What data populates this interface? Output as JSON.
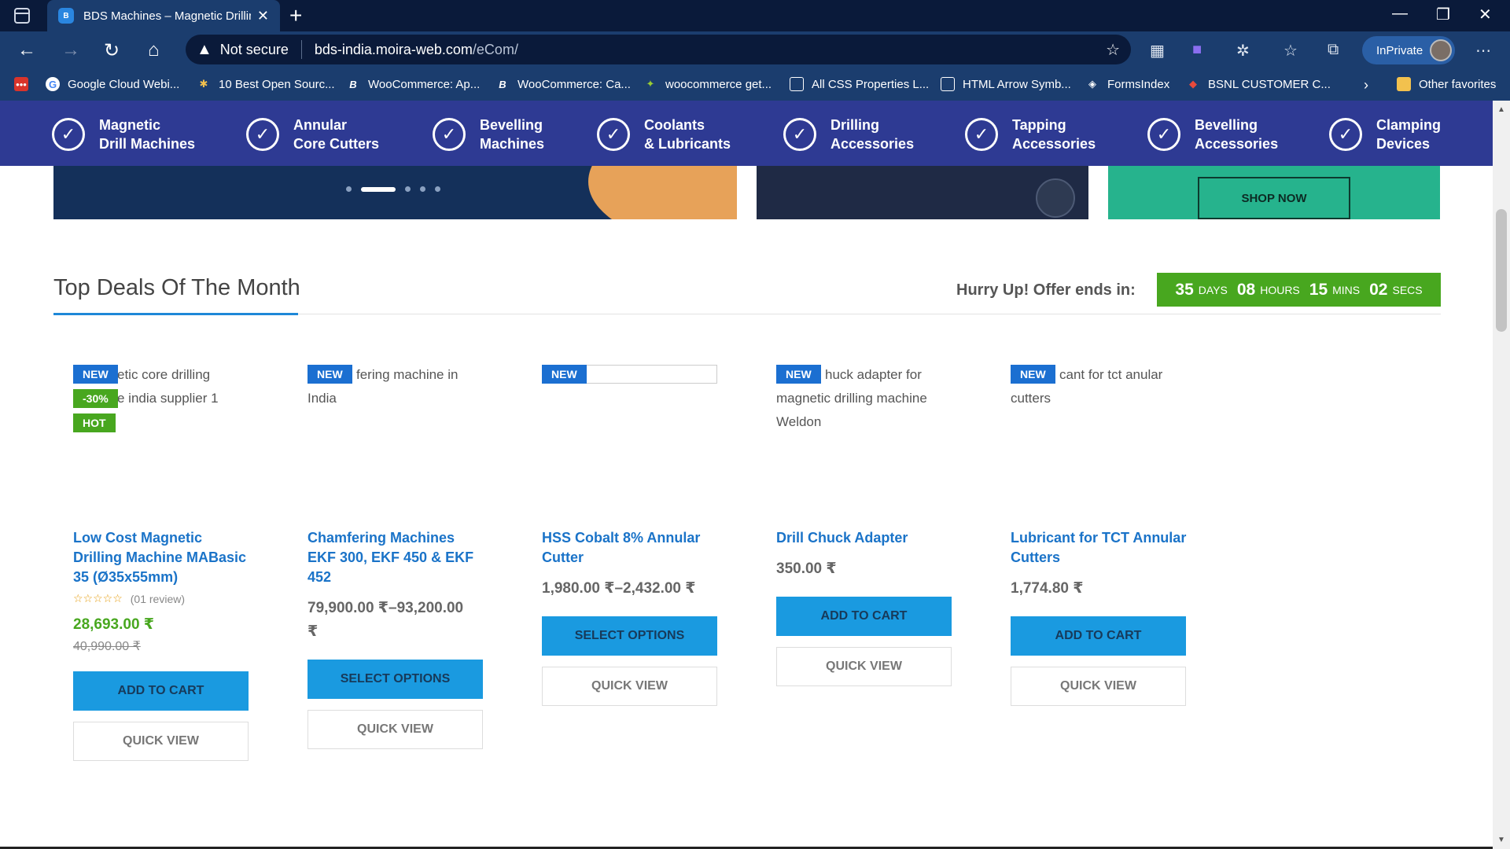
{
  "browser": {
    "tab_title": "BDS Machines – Magnetic Drillin",
    "url_host": "bds-india.moira-web.com",
    "url_path": "/eCom/",
    "security_label": "Not secure",
    "inprivate_label": "InPrivate",
    "favorites": [
      {
        "label": "Google Cloud Webi...",
        "icon": "google-icon"
      },
      {
        "label": "10 Best Open Sourc...",
        "icon": "search-bulb-icon"
      },
      {
        "label": "WooCommerce: Ap...",
        "icon": "bootstrap-icon"
      },
      {
        "label": "WooCommerce: Ca...",
        "icon": "bootstrap-icon"
      },
      {
        "label": "woocommerce get...",
        "icon": "spark-icon"
      },
      {
        "label": "All CSS Properties L...",
        "icon": "page-icon"
      },
      {
        "label": "HTML Arrow Symb...",
        "icon": "page-icon"
      },
      {
        "label": "FormsIndex",
        "icon": "forms-icon"
      },
      {
        "label": "BSNL CUSTOMER C...",
        "icon": "bsnl-icon"
      }
    ],
    "other_favorites": "Other favorites"
  },
  "site_nav": [
    {
      "line1": "Magnetic",
      "line2": "Drill Machines"
    },
    {
      "line1": "Annular",
      "line2": "Core Cutters"
    },
    {
      "line1": "Bevelling",
      "line2": "Machines"
    },
    {
      "line1": "Coolants",
      "line2": "& Lubricants"
    },
    {
      "line1": "Drilling",
      "line2": "Accessories"
    },
    {
      "line1": "Tapping",
      "line2": "Accessories"
    },
    {
      "line1": "Bevelling",
      "line2": "Accessories"
    },
    {
      "line1": "Clamping",
      "line2": "Devices"
    }
  ],
  "banner": {
    "shop_now": "SHOP NOW"
  },
  "deals": {
    "title": "Top Deals Of The Month",
    "hurry": "Hurry Up! Offer ends in:",
    "countdown": {
      "days": "35",
      "days_label": "DAYS",
      "hours": "08",
      "hours_label": "HOURS",
      "mins": "15",
      "mins_label": "MINS",
      "secs": "02",
      "secs_label": "SECS"
    }
  },
  "products": [
    {
      "img_alt_line1": "etic core drilling",
      "img_alt_line2": "e india supplier 1",
      "badges": {
        "new": "NEW",
        "sale": "-30%",
        "hot": "HOT"
      },
      "title": "Low Cost Magnetic Drilling Machine MABasic 35 (Ø35x55mm)",
      "stars": "☆☆☆☆☆",
      "reviews": "(01 review)",
      "price": "28,693.00 ₹",
      "old_price": "40,990.00 ₹",
      "button": "ADD TO CART",
      "quick_view": "QUICK VIEW"
    },
    {
      "img_alt_line1": "fering machine in",
      "img_alt_line2": "India",
      "badges": {
        "new": "NEW"
      },
      "title": "Chamfering Machines EKF 300, EKF 450 & EKF 452",
      "price": "79,900.00 ₹–93,200.00 ₹",
      "button": "SELECT OPTIONS",
      "quick_view": "QUICK VIEW"
    },
    {
      "badges": {
        "new": "NEW"
      },
      "title": "HSS Cobalt 8% Annular Cutter",
      "price": "1,980.00 ₹–2,432.00 ₹",
      "button": "SELECT OPTIONS",
      "quick_view": "QUICK VIEW"
    },
    {
      "img_alt_line1": "huck adapter for",
      "img_alt_line2": "magnetic drilling machine",
      "img_alt_line3": "Weldon",
      "badges": {
        "new": "NEW"
      },
      "title": "Drill Chuck Adapter",
      "price": "350.00 ₹",
      "button": "ADD TO CART",
      "quick_view": "QUICK VIEW"
    },
    {
      "img_alt_line1": "cant for tct anular",
      "img_alt_line2": "cutters",
      "badges": {
        "new": "NEW"
      },
      "title": "Lubricant for TCT Annular Cutters",
      "price": "1,774.80 ₹",
      "button": "ADD TO CART",
      "quick_view": "QUICK VIEW"
    }
  ]
}
